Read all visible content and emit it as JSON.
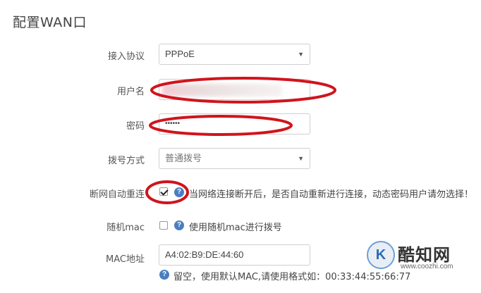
{
  "page": {
    "title": "配置WAN口"
  },
  "form": {
    "protocol": {
      "label": "接入协议",
      "value": "PPPoE"
    },
    "username": {
      "label": "用户名",
      "value": ""
    },
    "password": {
      "label": "密码",
      "value": "••••••"
    },
    "dial_mode": {
      "label": "拨号方式",
      "value": "普通拨号"
    },
    "auto_reconnect": {
      "label": "断网自动重连",
      "checked": true,
      "hint": "当网络连接断开后，是否自动重新进行连接，动态密码用户请勿选择！"
    },
    "random_mac": {
      "label": "随机mac",
      "checked": false,
      "hint": "使用随机mac进行拨号"
    },
    "mac_address": {
      "label": "MAC地址",
      "value": "A4:02:B9:DE:44:60",
      "hint": "留空，使用默认MAC,请使用格式如：00:33:44:55:66:77"
    }
  },
  "icons": {
    "help": "?"
  },
  "colors": {
    "annotation_red": "#d0141c",
    "help_blue": "#4a7fc0",
    "watermark_blue": "#2a6db8"
  },
  "watermark": {
    "logo_letter": "K",
    "name": "酷知网",
    "url": "www.coozhi.com"
  }
}
